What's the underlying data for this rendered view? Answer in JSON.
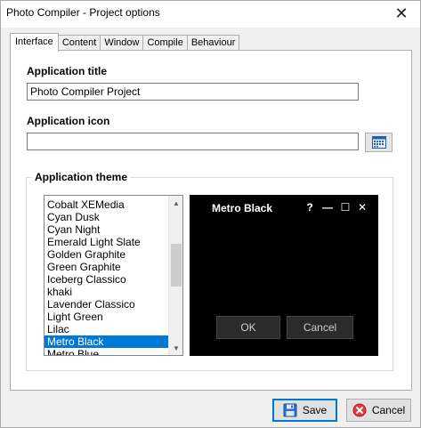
{
  "window": {
    "title": "Photo Compiler - Project options",
    "close_glyph": "✕"
  },
  "tabs": [
    {
      "label": "Interface",
      "active": true
    },
    {
      "label": "Content",
      "active": false
    },
    {
      "label": "Window",
      "active": false
    },
    {
      "label": "Compile",
      "active": false
    },
    {
      "label": "Behaviour",
      "active": false
    }
  ],
  "interface": {
    "app_title_label": "Application title",
    "app_title_value": "Photo Compiler Project",
    "app_icon_label": "Application icon",
    "app_icon_value": "",
    "browse_icon": "calendar-grid-icon",
    "theme_group_label": "Application theme",
    "themes": [
      "Cobalt XEMedia",
      "Cyan Dusk",
      "Cyan Night",
      "Emerald Light Slate",
      "Golden Graphite",
      "Green Graphite",
      "Iceberg Classico",
      "khaki",
      "Lavender Classico",
      "Light Green",
      "Lilac",
      "Metro Black",
      "Metro Blue"
    ],
    "selected_theme": "Metro Black",
    "list_scroll_position": 0.55
  },
  "preview": {
    "title": "Metro Black",
    "help_glyph": "?",
    "minimize_glyph": "—",
    "maximize_glyph": "☐",
    "close_glyph": "✕",
    "ok_label": "OK",
    "cancel_label": "Cancel",
    "background_color": "#000000"
  },
  "footer": {
    "save_label": "Save",
    "cancel_label": "Cancel",
    "save_icon": "floppy-disk-icon",
    "cancel_icon": "red-cancel-icon"
  },
  "colors": {
    "selection": "#0078d7",
    "dialog_bg": "#f0f0f0"
  }
}
